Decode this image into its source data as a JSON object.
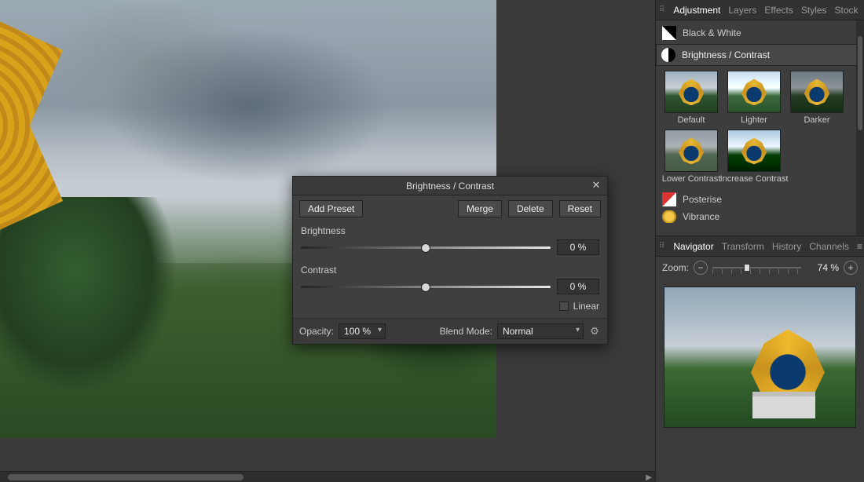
{
  "tabs_top": {
    "adjustment": "Adjustment",
    "layers": "Layers",
    "effects": "Effects",
    "styles": "Styles",
    "stock": "Stock"
  },
  "adjustments": {
    "bw": "Black & White",
    "bc": "Brightness / Contrast",
    "posterise": "Posterise",
    "vibrance": "Vibrance"
  },
  "presets": {
    "default": "Default",
    "lighter": "Lighter",
    "darker": "Darker",
    "lower_contrast": "Lower Contrast",
    "increase_contrast": "Increase Contrast"
  },
  "tabs_nav": {
    "navigator": "Navigator",
    "transform": "Transform",
    "history": "History",
    "channels": "Channels"
  },
  "navigator": {
    "zoom_label": "Zoom:",
    "zoom_value": "74 %"
  },
  "dialog": {
    "title": "Brightness / Contrast",
    "add_preset": "Add Preset",
    "merge": "Merge",
    "delete": "Delete",
    "reset": "Reset",
    "brightness_label": "Brightness",
    "brightness_value": "0 %",
    "contrast_label": "Contrast",
    "contrast_value": "0 %",
    "linear": "Linear",
    "opacity_label": "Opacity:",
    "opacity_value": "100 %",
    "blend_label": "Blend Mode:",
    "blend_value": "Normal"
  }
}
